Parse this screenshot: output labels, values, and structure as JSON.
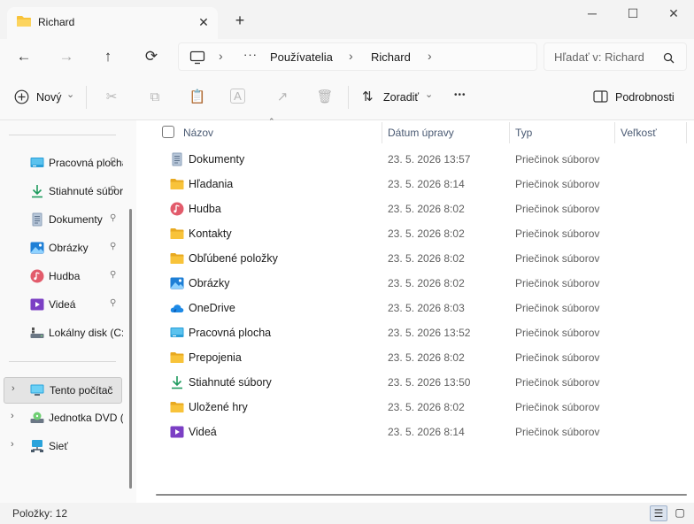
{
  "window": {
    "tab_title": "Richard",
    "new_tab_glyph": "+",
    "close_glyph": "✕",
    "minimize_glyph": "─",
    "maximize_glyph": "☐",
    "win_close_glyph": "✕"
  },
  "nav": {
    "back_glyph": "←",
    "forward_glyph": "→",
    "up_glyph": "↑",
    "refresh_glyph": "⟳",
    "breadcrumb": [
      "Používatelia",
      "Richard"
    ],
    "more_glyph": "···",
    "sep_glyph": "›",
    "search_placeholder": "Hľadať v: Richard"
  },
  "toolbar": {
    "new_label": "Nový",
    "sort_label": "Zoradiť",
    "more_glyph": "•••",
    "details_label": "Podrobnosti",
    "dropdown_glyph": "⌄"
  },
  "sidebar": {
    "quick_access": [
      {
        "label": "Pracovná plocha",
        "icon": "desktop-icon",
        "pinned": true
      },
      {
        "label": "Stiahnuté súbory",
        "icon": "download-icon",
        "pinned": true
      },
      {
        "label": "Dokumenty",
        "icon": "document-icon",
        "pinned": true
      },
      {
        "label": "Obrázky",
        "icon": "picture-icon",
        "pinned": true
      },
      {
        "label": "Hudba",
        "icon": "music-icon",
        "pinned": true
      },
      {
        "label": "Videá",
        "icon": "video-icon",
        "pinned": true
      },
      {
        "label": "Lokálny disk (C:)",
        "icon": "drive-icon",
        "pinned": false
      }
    ],
    "locations": [
      {
        "label": "Tento počítač",
        "icon": "computer-icon",
        "selected": true
      },
      {
        "label": "Jednotka DVD (D:)",
        "icon": "dvd-icon",
        "selected": false
      },
      {
        "label": "Sieť",
        "icon": "network-icon",
        "selected": false
      }
    ],
    "pin_glyph": "📌",
    "chevron_glyph": "›"
  },
  "columns": {
    "name": "Názov",
    "date": "Dátum úpravy",
    "type": "Typ",
    "size": "Veľkosť"
  },
  "files": [
    {
      "name": "Dokumenty",
      "date": "23. 5. 2026 13:57",
      "type": "Priečinok súborov",
      "icon": "document-icon"
    },
    {
      "name": "Hľadania",
      "date": "23. 5. 2026 8:14",
      "type": "Priečinok súborov",
      "icon": "folder-icon"
    },
    {
      "name": "Hudba",
      "date": "23. 5. 2026 8:02",
      "type": "Priečinok súborov",
      "icon": "music-icon"
    },
    {
      "name": "Kontakty",
      "date": "23. 5. 2026 8:02",
      "type": "Priečinok súborov",
      "icon": "folder-icon"
    },
    {
      "name": "Obľúbené položky",
      "date": "23. 5. 2026 8:02",
      "type": "Priečinok súborov",
      "icon": "folder-icon"
    },
    {
      "name": "Obrázky",
      "date": "23. 5. 2026 8:02",
      "type": "Priečinok súborov",
      "icon": "picture-icon"
    },
    {
      "name": "OneDrive",
      "date": "23. 5. 2026 8:03",
      "type": "Priečinok súborov",
      "icon": "cloud-icon"
    },
    {
      "name": "Pracovná plocha",
      "date": "23. 5. 2026 13:52",
      "type": "Priečinok súborov",
      "icon": "desktop-icon"
    },
    {
      "name": "Prepojenia",
      "date": "23. 5. 2026 8:02",
      "type": "Priečinok súborov",
      "icon": "folder-icon"
    },
    {
      "name": "Stiahnuté súbory",
      "date": "23. 5. 2026 13:50",
      "type": "Priečinok súborov",
      "icon": "download-icon"
    },
    {
      "name": "Uložené hry",
      "date": "23. 5. 2026 8:02",
      "type": "Priečinok súborov",
      "icon": "folder-icon"
    },
    {
      "name": "Videá",
      "date": "23. 5. 2026 8:14",
      "type": "Priečinok súborov",
      "icon": "video-icon"
    }
  ],
  "status": {
    "items_text": "Položky: 12"
  },
  "colors": {
    "folder": "#f8c33a",
    "accent": "#0067c0"
  }
}
